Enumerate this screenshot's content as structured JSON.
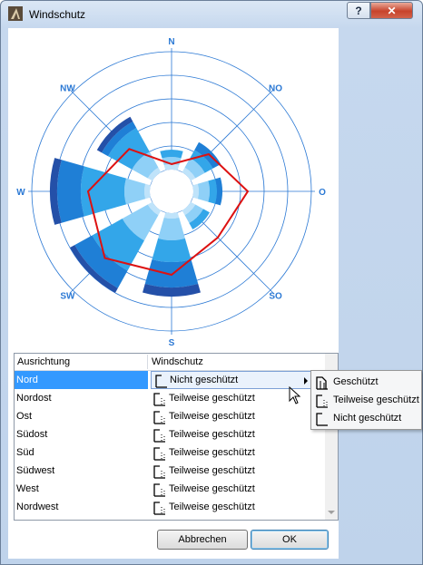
{
  "window": {
    "title": "Windschutz",
    "help_label": "?",
    "close_label": "✕",
    "app_icon": "app-triangle-icon"
  },
  "rose": {
    "directions": [
      "N",
      "NO",
      "O",
      "SO",
      "S",
      "SW",
      "W",
      "NW"
    ]
  },
  "table": {
    "columns": [
      "Ausrichtung",
      "Windschutz"
    ],
    "rows": [
      {
        "direction": "Nord",
        "protection": "Nicht geschützt",
        "icon": "unprotected-icon"
      },
      {
        "direction": "Nordost",
        "protection": "Teilweise geschützt",
        "icon": "partial-protection-icon"
      },
      {
        "direction": "Ost",
        "protection": "Teilweise geschützt",
        "icon": "partial-protection-icon"
      },
      {
        "direction": "Südost",
        "protection": "Teilweise geschützt",
        "icon": "partial-protection-icon"
      },
      {
        "direction": "Süd",
        "protection": "Teilweise geschützt",
        "icon": "partial-protection-icon"
      },
      {
        "direction": "Südwest",
        "protection": "Teilweise geschützt",
        "icon": "partial-protection-icon"
      },
      {
        "direction": "West",
        "protection": "Teilweise geschützt",
        "icon": "partial-protection-icon"
      },
      {
        "direction": "Nordwest",
        "protection": "Teilweise geschützt",
        "icon": "partial-protection-icon"
      }
    ]
  },
  "menu": {
    "items": [
      {
        "label": "Geschützt",
        "icon": "protected-icon"
      },
      {
        "label": "Teilweise geschützt",
        "icon": "partial-protection-icon"
      },
      {
        "label": "Nicht geschützt",
        "icon": "unprotected-icon"
      }
    ]
  },
  "buttons": {
    "cancel": "Abbrechen",
    "ok": "OK"
  },
  "colors": {
    "accent": "#3399ff",
    "ring": "#2a78d4",
    "polygon": "#dd1111"
  }
}
